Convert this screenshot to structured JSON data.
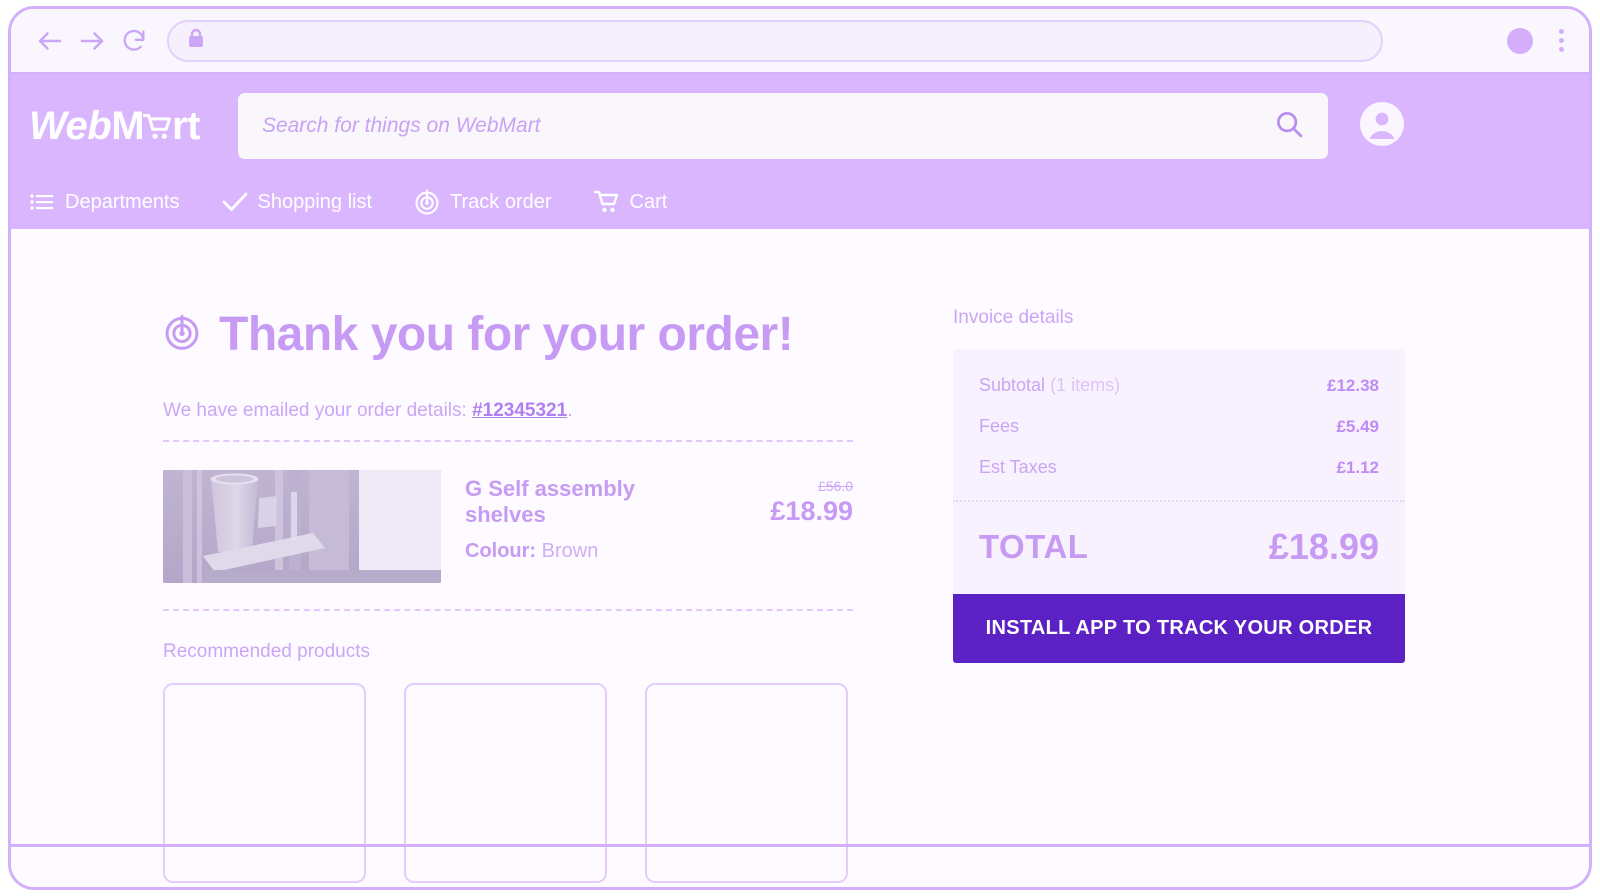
{
  "browser": {
    "back_icon": "back-arrow-icon",
    "forward_icon": "forward-arrow-icon",
    "reload_icon": "reload-icon",
    "lock_icon": "lock-icon",
    "url_value": "",
    "url_placeholder": "",
    "profile_icon": "profile-dot-icon",
    "menu_icon": "kebab-menu-icon"
  },
  "header": {
    "logo": {
      "part1": "Web",
      "part2": "M",
      "cart_icon": "shopping-cart-icon",
      "part3": "rt"
    },
    "search": {
      "value": "",
      "placeholder": "Search for things on WebMart",
      "icon": "search-icon"
    },
    "account_icon": "user-avatar-icon",
    "nav": [
      {
        "label": "Departments",
        "icon": "menu-list-icon"
      },
      {
        "label": "Shopping list",
        "icon": "check-icon"
      },
      {
        "label": "Track order",
        "icon": "radar-target-icon"
      },
      {
        "label": "Cart",
        "icon": "shopping-cart-icon"
      }
    ]
  },
  "main": {
    "thanks_icon": "radar-target-icon",
    "thanks_title": "Thank you for your order!",
    "email_prefix": "We have emailed your order details: ",
    "order_number": "#12345321",
    "email_suffix": ".",
    "product": {
      "image_alt": "product-photo",
      "title": "G Self assembly shelves",
      "colour_label": "Colour:",
      "colour_value": "Brown",
      "old_price": "£56.0",
      "price": "£18.99"
    },
    "recommended_title": "Recommended products",
    "recommended_cards": [
      "",
      "",
      ""
    ]
  },
  "invoice": {
    "title": "Invoice details",
    "lines": [
      {
        "label": "Subtotal",
        "sublabel": " (1 items)",
        "value": "£12.38"
      },
      {
        "label": "Fees",
        "sublabel": "",
        "value": "£5.49"
      },
      {
        "label": "Est Taxes",
        "sublabel": "",
        "value": "£1.12"
      }
    ],
    "total_label": "TOTAL",
    "total_value": "£18.99",
    "install_button": "INSTALL APP TO TRACK YOUR ORDER"
  },
  "colors": {
    "header_purple": "#d9b6fd",
    "accent_light": "#c79bf4",
    "button_violet": "#5b21c4",
    "page_bg": "#fdfbff",
    "frame_border": "#d3b0fb"
  }
}
